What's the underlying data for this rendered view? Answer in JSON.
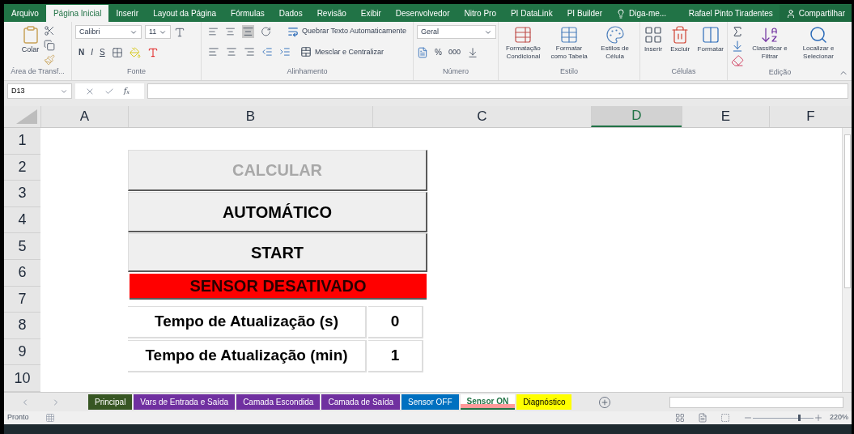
{
  "menu_tabs": [
    {
      "label": "Arquivo",
      "selected": false
    },
    {
      "label": "Página Inicial",
      "selected": true
    },
    {
      "label": "Inserir",
      "selected": false
    },
    {
      "label": "Layout da Página",
      "selected": false
    },
    {
      "label": "Fórmulas",
      "selected": false
    },
    {
      "label": "Dados",
      "selected": false
    },
    {
      "label": "Revisão",
      "selected": false
    },
    {
      "label": "Exibir",
      "selected": false
    },
    {
      "label": "Desenvolvedor",
      "selected": false
    },
    {
      "label": "Nitro Pro",
      "selected": false
    },
    {
      "label": "PI DataLink",
      "selected": false
    },
    {
      "label": "PI Builder",
      "selected": false
    }
  ],
  "tell_me": "Diga-me...",
  "user": "Rafael Pinto Tiradentes",
  "share": "Compartilhar",
  "ribbon": {
    "clipboard": {
      "paste": "Colar",
      "group": "Área de Transf..."
    },
    "font": {
      "name": "Calibri",
      "size": "11",
      "styles": [
        "N",
        "I",
        "S"
      ],
      "group": "Fonte"
    },
    "alignment": {
      "wrap": "Quebrar Texto Automaticamente",
      "merge": "Mesclar e Centralizar",
      "group": "Alinhamento"
    },
    "number": {
      "format": "Geral",
      "percent": "%",
      "thousands": "000",
      "group": "Número"
    },
    "styles": {
      "items": [
        "Formatação Condicional",
        "Formatar como Tabela",
        "Estilos de Célula"
      ],
      "group": "Estilo"
    },
    "cells": {
      "items": [
        "Inserir",
        "Excluir",
        "Formatar"
      ],
      "group": "Células"
    },
    "editing": {
      "items": [
        "Classificar e Filtrar",
        "Localizar e Selecionar"
      ],
      "group": "Edição"
    }
  },
  "name_box": "D13",
  "function_label": "f$_{x}$",
  "columns": [
    {
      "label": "A",
      "selected": false
    },
    {
      "label": "B",
      "selected": false
    },
    {
      "label": "C",
      "selected": false
    },
    {
      "label": "D",
      "selected": true
    },
    {
      "label": "E",
      "selected": false
    },
    {
      "label": "F",
      "selected": false
    }
  ],
  "rows": [
    "1",
    "2",
    "3",
    "4",
    "5",
    "6",
    "7",
    "8",
    "9",
    "10"
  ],
  "shapes": [
    {
      "kind": "button",
      "label": "CALCULAR",
      "disabled": true
    },
    {
      "kind": "button",
      "label": "AUTOMÁTICO",
      "disabled": false
    },
    {
      "kind": "button",
      "label": "START",
      "disabled": false
    },
    {
      "kind": "status",
      "label": "SENSOR DESATIVADO",
      "color": "#ff0000"
    },
    {
      "kind": "field",
      "label": "Tempo de Atualização (s)",
      "value": "0"
    },
    {
      "kind": "field",
      "label": "Tempo de Atualização (min)",
      "value": "1"
    }
  ],
  "sheet_tabs": [
    {
      "label": "Principal",
      "color": "#375623",
      "selected": false
    },
    {
      "label": "Vars de Entrada e Saída",
      "color": "#7030a0",
      "selected": false
    },
    {
      "label": "Camada Escondida",
      "color": "#7030a0",
      "selected": false
    },
    {
      "label": "Camada de Saída",
      "color": "#7030a0",
      "selected": false
    },
    {
      "label": "Sensor OFF",
      "color": "#0070c0",
      "selected": false
    },
    {
      "label": "Sensor ON",
      "color": "#ff9999",
      "selected": true
    },
    {
      "label": "Diagnóstico",
      "color": "#ffff00",
      "selected": false
    }
  ],
  "status": "Pronto",
  "zoom_slider": {
    "level": 0.78
  },
  "zoom": "220%"
}
